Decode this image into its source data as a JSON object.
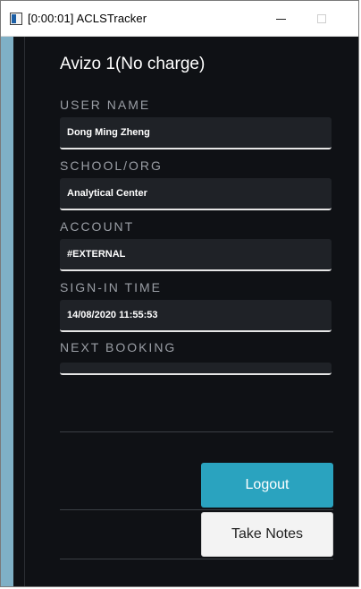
{
  "window": {
    "title": "[0:00:01] ACLSTracker",
    "controls": {
      "minimize": "minimize",
      "maximize": "maximize"
    }
  },
  "instrument": {
    "title": "Avizo 1(No charge)"
  },
  "fields": [
    {
      "label": "USER NAME",
      "value": "Dong Ming Zheng"
    },
    {
      "label": "SCHOOL/ORG",
      "value": "Analytical Center"
    },
    {
      "label": "ACCOUNT",
      "value": "#EXTERNAL"
    },
    {
      "label": "SIGN-IN TIME",
      "value": "14/08/2020 11:55:53"
    },
    {
      "label": "NEXT BOOKING",
      "value": ""
    }
  ],
  "buttons": {
    "logout": "Logout",
    "take_notes": "Take Notes"
  },
  "colors": {
    "background": "#0f1115",
    "field_bg": "#1f2227",
    "accent": "#2aa3bf",
    "label": "#9a9ea5",
    "left_strip": "#7fb0c6"
  }
}
